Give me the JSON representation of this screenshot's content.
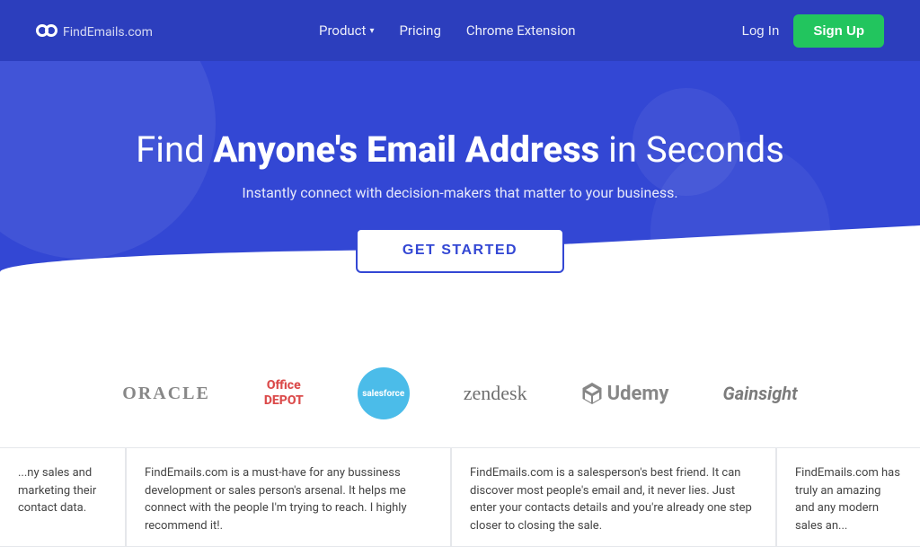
{
  "navbar": {
    "logo_text": "FindEmails",
    "logo_tld": ".com",
    "nav_items": [
      {
        "label": "Product",
        "has_dropdown": true
      },
      {
        "label": "Pricing",
        "has_dropdown": false
      },
      {
        "label": "Chrome Extension",
        "has_dropdown": false
      }
    ],
    "login_label": "Log In",
    "signup_label": "Sign Up"
  },
  "hero": {
    "title_prefix": "Find ",
    "title_bold": "Anyone's Email Address",
    "title_suffix": " in Seconds",
    "subtitle": "Instantly connect with decision-makers that matter to your business.",
    "cta_label": "GET STARTED"
  },
  "logos": [
    {
      "name": "oracle",
      "display": "ORACLE"
    },
    {
      "name": "office-depot",
      "line1": "Office",
      "line2": "DEPOT"
    },
    {
      "name": "salesforce",
      "display": "salesforce"
    },
    {
      "name": "zendesk",
      "display": "zendesk"
    },
    {
      "name": "udemy",
      "display": "Udemy"
    },
    {
      "name": "gainsight",
      "display": "Gainsight"
    }
  ],
  "testimonials": [
    {
      "text": "...ny sales and marketing their contact data.",
      "partial": "left"
    },
    {
      "text": "FindEmails.com is a must-have for any bussiness development or sales person's arsenal. It helps me connect with the people I'm trying to reach. I highly recommend it!.",
      "partial": false
    },
    {
      "text": "FindEmails.com is a salesperson's best friend. It can discover most people's email and, it never lies. Just enter your contacts details and you're already one step closer to closing the sale.",
      "partial": false
    },
    {
      "text": "FindEmails.com has truly an amazing and any modern sales an...",
      "partial": "right"
    }
  ]
}
